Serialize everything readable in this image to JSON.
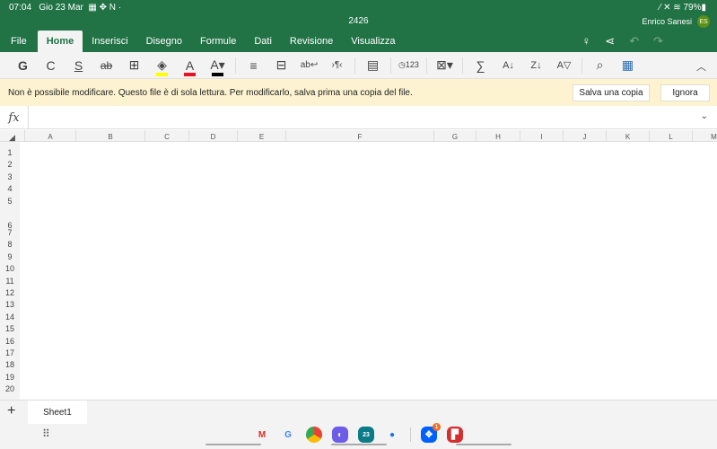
{
  "status": {
    "time": "07:04",
    "date": "Gio 23 Mar",
    "battery": "79%"
  },
  "title": "2426",
  "user": {
    "name": "Enrico Sanesi",
    "initials": "ES"
  },
  "tabs": [
    {
      "label": "File"
    },
    {
      "label": "Home"
    },
    {
      "label": "Inserisci"
    },
    {
      "label": "Disegno"
    },
    {
      "label": "Formule"
    },
    {
      "label": "Dati"
    },
    {
      "label": "Revisione"
    },
    {
      "label": "Visualizza"
    }
  ],
  "ribbon": {
    "bold": "G",
    "italic": "C",
    "underline": "S",
    "strike": "ab",
    "font_color_letter": "A",
    "highlight_color": "#ffff00",
    "font_color": "#e81123",
    "fill_color": "#000000",
    "num_format": "123"
  },
  "notice": {
    "message": "Non è possibile modificare. Questo file è di sola lettura. Per modificarlo, salva prima una copia del file.",
    "save_copy": "Salva una copia",
    "ignore": "Ignora"
  },
  "formula": {
    "fx": "fx",
    "value": ""
  },
  "columns": [
    "A",
    "B",
    "C",
    "D",
    "E",
    "F",
    "G",
    "H",
    "I",
    "J",
    "K",
    "L",
    "M"
  ],
  "rows": [
    "1",
    "2",
    "3",
    "4",
    "5",
    "6",
    "7",
    "8",
    "9",
    "10",
    "11",
    "12",
    "13",
    "14",
    "15",
    "16",
    "17",
    "18",
    "19",
    "20"
  ],
  "sheets": [
    {
      "label": "Sheet1"
    }
  ],
  "dock": {
    "calendar_day": "23",
    "dropbox_badge": "1"
  }
}
